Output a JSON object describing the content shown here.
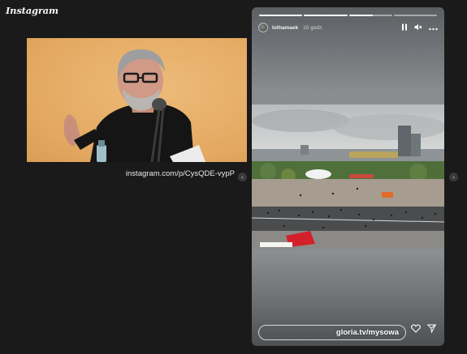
{
  "app": {
    "brand": "Instagram"
  },
  "preview": {
    "caption": "instagram.com/p/CysQDE-vypP",
    "bg_color": "#e6ad67"
  },
  "navigation": {
    "prev_glyph": "‹",
    "next_glyph": "›"
  },
  "story": {
    "username": "lothamaek",
    "time": "15 godz.",
    "progress": [
      1.0,
      1.0,
      0.55,
      0.0
    ],
    "overlay_link": "gloria.tv/mysowa",
    "reply_placeholder": "",
    "icons": [
      "pause-icon",
      "volume-icon",
      "more-icon",
      "heart-icon",
      "send-icon"
    ]
  }
}
